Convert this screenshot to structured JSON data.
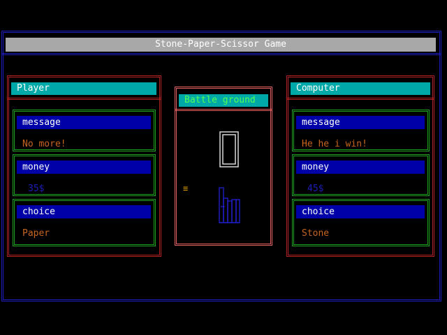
{
  "window": {
    "title": "Stone-Paper-Scissor Game"
  },
  "player": {
    "header": "Player",
    "message_label": "message",
    "message_value": "No more!",
    "money_label": "money",
    "money_value": "35$",
    "choice_label": "choice",
    "choice_value": "Paper"
  },
  "computer": {
    "header": "Computer",
    "message_label": "message",
    "message_value": "He he i win!",
    "money_label": "money",
    "money_value": "45$",
    "choice_label": "choice",
    "choice_value": "Stone"
  },
  "battle": {
    "title": "Battle ground",
    "marker": "≡"
  },
  "colors": {
    "background": "#000000",
    "title_bar": "#a8a8a8",
    "header_bar": "#00a8a8",
    "label_bar": "#0000a8",
    "value_text": "#c8641e",
    "money_text": "#1c1cb8",
    "outer_frame": "#1c1cb8",
    "panel_frame": "#b02020",
    "field_frame": "#1fa01f",
    "battle_frame": "#e06060"
  }
}
